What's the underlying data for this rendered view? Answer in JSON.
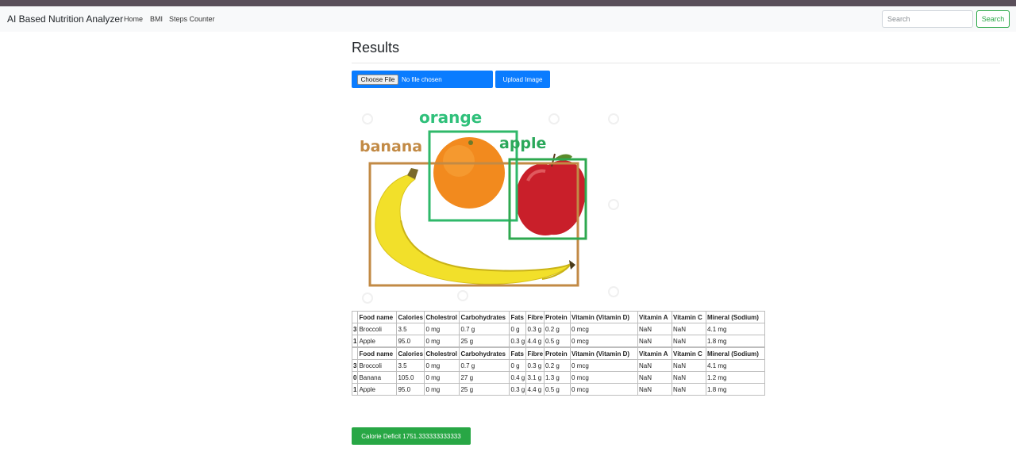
{
  "navbar": {
    "brand": "AI Based Nutrition Analyzer",
    "links": [
      "Home",
      "BMI",
      "Steps Counter"
    ],
    "search_placeholder": "Search",
    "search_button": "Search"
  },
  "main": {
    "title": "Results",
    "file_input": {
      "button_label": "Choose File",
      "status": "No file chosen"
    },
    "upload_button": "Upload Image",
    "image": {
      "labels": [
        "orange",
        "banana",
        "apple"
      ],
      "colors": {
        "orange_box": "#2fb86a",
        "banana_box": "#c28a45",
        "apple_box": "#2ea84f",
        "orange_label": "#2fc07a",
        "banana_label": "#c28a45",
        "apple_label": "#2aa85a"
      }
    },
    "tables": [
      {
        "headers": [
          "",
          "Food name",
          "Calories",
          "Cholestrol",
          "Carbohydrates",
          "Fats",
          "Fibre",
          "Protein",
          "Vitamin (Vitamin D)",
          "Vitamin A",
          "Vitamin C",
          "Mineral (Sodium)"
        ],
        "rows": [
          [
            "3",
            "Broccoli",
            "3.5",
            "0 mg",
            "0.7 g",
            "0 g",
            "0.3 g",
            "0.2 g",
            "0 mcg",
            "NaN",
            "NaN",
            "4.1 mg"
          ],
          [
            "1",
            "Apple",
            "95.0",
            "0 mg",
            "25 g",
            "0.3 g",
            "4.4 g",
            "0.5 g",
            "0 mcg",
            "NaN",
            "NaN",
            "1.8 mg"
          ]
        ]
      },
      {
        "headers": [
          "",
          "Food name",
          "Calories",
          "Cholestrol",
          "Carbohydrates",
          "Fats",
          "Fibre",
          "Protein",
          "Vitamin (Vitamin D)",
          "Vitamin A",
          "Vitamin C",
          "Mineral (Sodium)"
        ],
        "rows": [
          [
            "3",
            "Broccoli",
            "3.5",
            "0 mg",
            "0.7 g",
            "0 g",
            "0.3 g",
            "0.2 g",
            "0 mcg",
            "NaN",
            "NaN",
            "4.1 mg"
          ],
          [
            "0",
            "Banana",
            "105.0",
            "0 mg",
            "27 g",
            "0.4 g",
            "3.1 g",
            "1.3 g",
            "0 mcg",
            "NaN",
            "NaN",
            "1.2 mg"
          ],
          [
            "1",
            "Apple",
            "95.0",
            "0 mg",
            "25 g",
            "0.3 g",
            "4.4 g",
            "0.5 g",
            "0 mcg",
            "NaN",
            "NaN",
            "1.8 mg"
          ]
        ]
      }
    ],
    "deficit_button": "Calorie Deficit 1751.333333333333"
  }
}
